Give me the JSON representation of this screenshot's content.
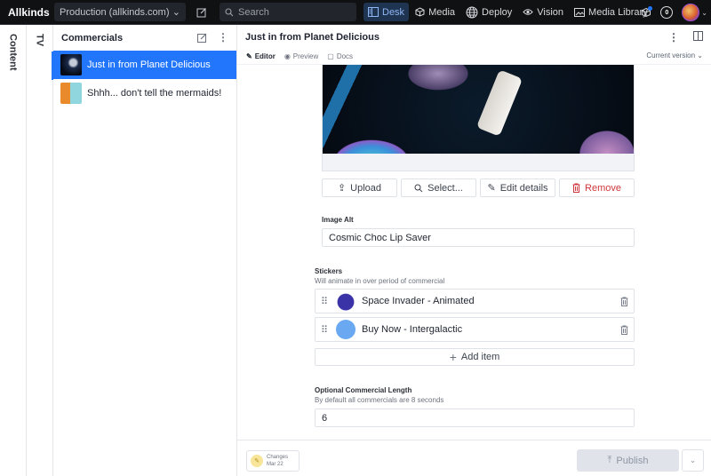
{
  "topbar": {
    "brand": "Allkinds",
    "dataset": "Production (allkinds.com)",
    "search_placeholder": "Search",
    "nav": [
      {
        "label": "Desk",
        "icon": "desk-icon",
        "active": true
      },
      {
        "label": "Media",
        "icon": "cube-icon"
      },
      {
        "label": "Deploy",
        "icon": "globe-icon"
      },
      {
        "label": "Vision",
        "icon": "eye-icon"
      },
      {
        "label": "Media Library",
        "icon": "image-icon"
      }
    ],
    "notifications_count": "0"
  },
  "vertical_tabs": [
    "Content",
    "TV"
  ],
  "list": {
    "title": "Commercials",
    "items": [
      {
        "title": "Just in from Planet Delicious",
        "selected": true
      },
      {
        "title": "Shhh... don't tell the mermaids!"
      }
    ]
  },
  "document": {
    "title": "Just in from Planet Delicious",
    "tabs": [
      "Editor",
      "Preview",
      "Docs"
    ],
    "version": "Current version",
    "image_buttons": [
      "Upload",
      "Select...",
      "Edit details",
      "Remove"
    ],
    "image_alt": {
      "label": "Image Alt",
      "value": "Cosmic Choc Lip Saver"
    },
    "stickers": {
      "label": "Stickers",
      "description": "Will animate in over period of commercial",
      "items": [
        "Space Invader - Animated",
        "Buy Now - Intergalactic"
      ],
      "add_label": "Add item"
    },
    "length": {
      "label": "Optional Commercial Length",
      "description": "By default all commercials are 8 seconds",
      "value": "6"
    }
  },
  "footer": {
    "changes_label": "Changes",
    "changes_date": "Mar 22",
    "publish_label": "Publish"
  },
  "colors": {
    "accent": "#2276fc",
    "danger": "#d1373c",
    "topbar": "#101112"
  }
}
